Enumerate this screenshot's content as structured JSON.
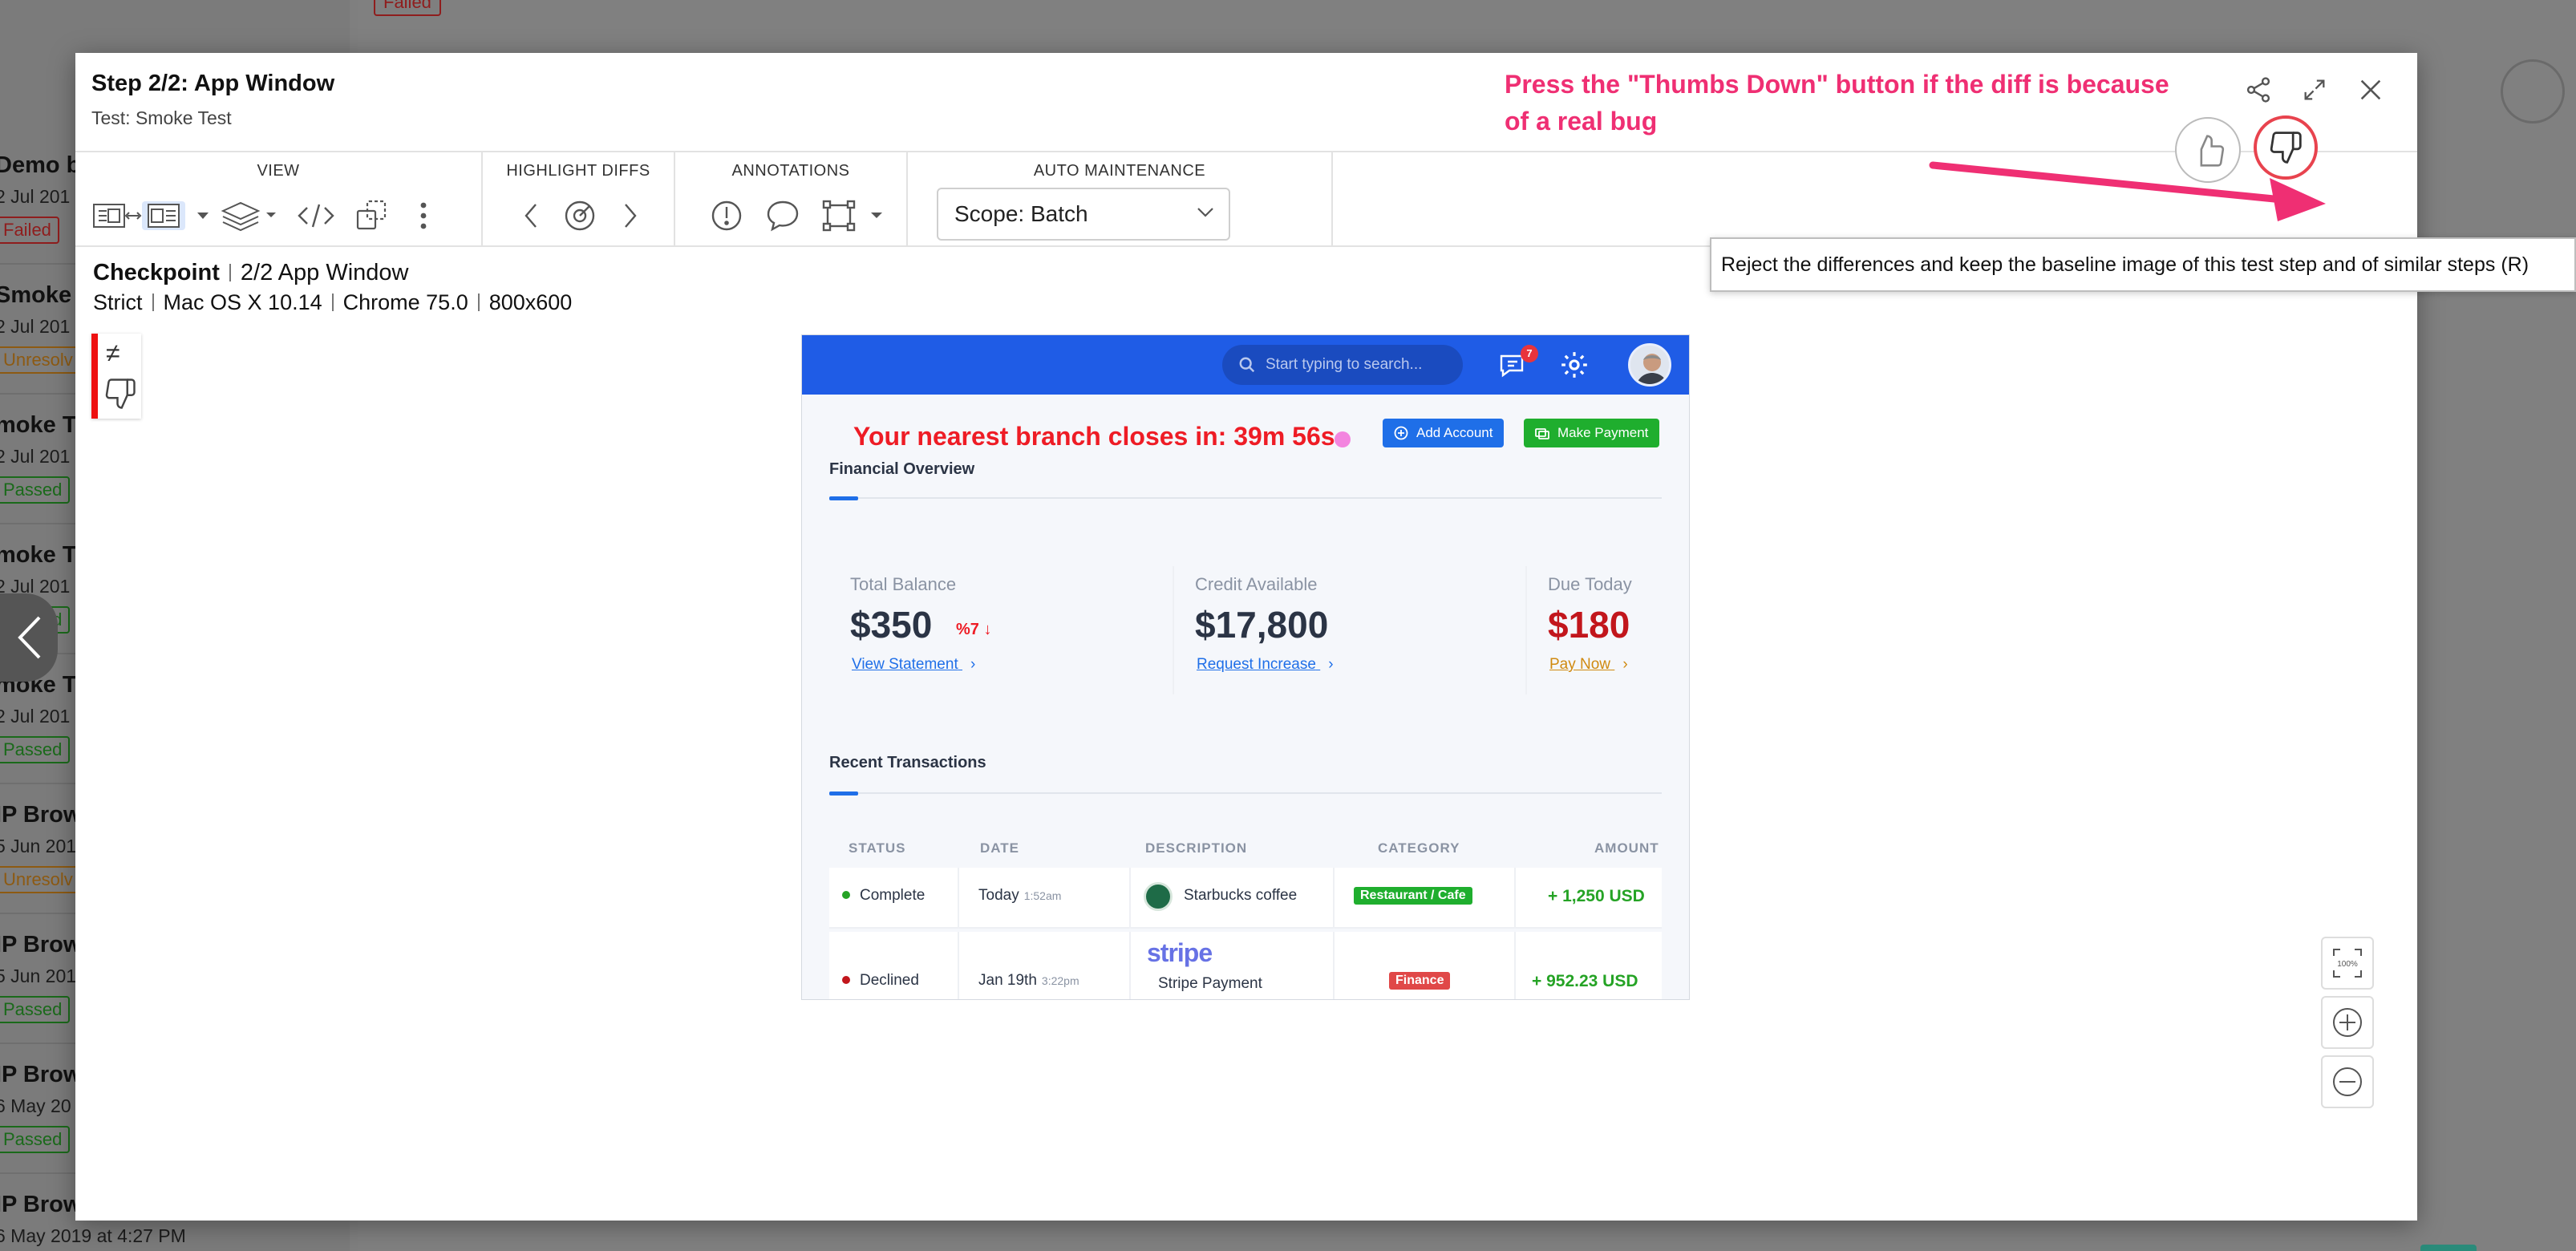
{
  "background": {
    "list_items": [
      {
        "title": "Demo ba",
        "date": "2 Jul 201",
        "status": "Failed",
        "kind": "failed"
      },
      {
        "title": "Smoke T",
        "date": "2 Jul 201",
        "status": "Unresolv",
        "kind": "unres"
      },
      {
        "title": "moke T",
        "date": "2 Jul 201",
        "status": "Passed",
        "kind": "passed"
      },
      {
        "title": "moke T",
        "date": "2 Jul 201",
        "status": "Passed",
        "kind": "passed"
      },
      {
        "title": "moke T",
        "date": "2 Jul 201",
        "status": "Passed",
        "kind": "passed"
      },
      {
        "title": "IP Brow",
        "date": "5 Jun 201",
        "status": "Unresolv",
        "kind": "unres"
      },
      {
        "title": "IP Brow",
        "date": "5 Jun 201",
        "status": "Passed",
        "kind": "passed"
      },
      {
        "title": "IP Brow",
        "date": "6 May 20",
        "status": "Passed",
        "kind": "passed"
      },
      {
        "title": "IP Brow",
        "date": "6 May 2019 at 4:27 PM",
        "status": "",
        "kind": "none"
      }
    ],
    "top_badge": "Failed"
  },
  "modal": {
    "title": "Step 2/2: App Window",
    "subtitle": "Test: Smoke Test",
    "toolbar": {
      "view_label": "VIEW",
      "highlight_label": "HIGHLIGHT DIFFS",
      "annotations_label": "ANNOTATIONS",
      "auto_label": "AUTO MAINTENANCE",
      "scope_value": "Scope: Batch"
    },
    "annotation_text": "Press the \"Thumbs Down\" button if the diff is because of a real bug",
    "tooltip": "Reject the differences and keep the baseline image of this test step and of similar steps (R)",
    "checkpoint": {
      "label": "Checkpoint",
      "name": "2/2 App Window",
      "match_level": "Strict",
      "os": "Mac OS X 10.14",
      "browser": "Chrome 75.0",
      "viewport": "800x600"
    },
    "diff_symbol": "≠",
    "zoom_fit_label": "100%"
  },
  "screenshot": {
    "search_placeholder": "Start typing to search...",
    "notification_count": "7",
    "branch_text": "Your nearest branch closes in: 39m 56s",
    "add_account": "Add Account",
    "make_payment": "Make Payment",
    "financial_overview": "Financial Overview",
    "cards": [
      {
        "label": "Total Balance",
        "value": "$350",
        "delta": "%7 ↓",
        "link": "View Statement"
      },
      {
        "label": "Credit Available",
        "value": "$17,800",
        "link": "Request Increase"
      },
      {
        "label": "Due Today",
        "value": "$180",
        "link": "Pay Now"
      }
    ],
    "recent_transactions": "Recent Transactions",
    "table_headers": [
      "STATUS",
      "DATE",
      "DESCRIPTION",
      "CATEGORY",
      "AMOUNT"
    ],
    "rows": [
      {
        "status": "Complete",
        "date": "Today",
        "time": "1:52am",
        "description": "Starbucks coffee",
        "category": "Restaurant / Cafe",
        "amount": "+ 1,250 USD"
      },
      {
        "status": "Declined",
        "date": "Jan 19th",
        "time": "3:22pm",
        "logo": "stripe",
        "description": "Stripe Payment",
        "category": "Finance",
        "amount": "+ 952.23 USD"
      }
    ],
    "colors": {
      "primary": "#1f5ce6",
      "danger": "#ee1c25",
      "success": "#25a325",
      "annotation": "#ef2f73"
    }
  }
}
